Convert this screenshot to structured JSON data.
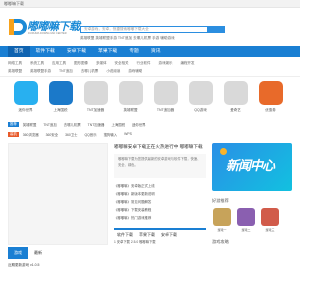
{
  "topbar": {
    "text": "嘟嘟嘛下载"
  },
  "header": {
    "logo_text": "嘟嘟嘛下载",
    "logo_sub": "DUDUMA DOWNLOAD CENTER",
    "search_placeholder": "安卓游戏，安卓，快捷搜索嘟嘟下载大全",
    "hotwords": "英雄联盟 英雄联盟手游 TNT追加 去哪儿机票 手游 辅助游戏"
  },
  "nav": {
    "items": [
      "首页",
      "软件下载",
      "安卓下载",
      "苹果下载",
      "专题",
      "资讯"
    ]
  },
  "subnav": {
    "row1": [
      "网络工具",
      "系统工具",
      "应用工具",
      "图形图像",
      "多媒体",
      "安全相关",
      "行业软件",
      "游戏娱乐",
      "编程开发"
    ],
    "row2": [
      "英雄联盟",
      "英雄联盟手游",
      "TNT追加",
      "去哪儿机票",
      "小说阅读",
      "游戏辅助"
    ]
  },
  "apps": [
    {
      "name": "迷你世界",
      "color": "#28b0f0"
    },
    {
      "name": "上海国税",
      "color": "#1b79c9"
    },
    {
      "name": "TNT加速器",
      "color": "#d9d9d9"
    },
    {
      "name": "英雄联盟",
      "color": "#d9d9d9"
    },
    {
      "name": "TNT追加器",
      "color": "#d9d9d9"
    },
    {
      "name": "QQ游戏",
      "color": "#d9d9d9"
    },
    {
      "name": "爱奇艺",
      "color": "#d9d9d9"
    },
    {
      "name": "优惠券",
      "color": "#e86a2a"
    }
  ],
  "tagrows": [
    {
      "tag": "推荐",
      "color": "#1a7fd3",
      "words": [
        "英雄联盟",
        "TNT追加",
        "去哪儿机票",
        "TNT加速器",
        "上海国税",
        "迷你世界"
      ]
    },
    {
      "tag": "装机",
      "color": "#e85a2a",
      "words": [
        "360浏览器",
        "360安全",
        "360卫士",
        "QQ音乐",
        "搜狗输入",
        "WPS"
      ]
    }
  ],
  "slider": {
    "tabs": [
      "游戏",
      "最新"
    ],
    "foot": "近期更新游戏 v1.0.5"
  },
  "news": {
    "headline": "嘟嘟嘛安卓下载正在火热进行中 嘟嘟嘛下载",
    "summary": "嘟嘟嘛下载为您提供最新的安卓游戏与软件下载，快速、安全、绿色。",
    "list": [
      "《嘟嘟嘛》安卓版正式上线",
      "《嘟嘟嘛》新版本更新说明",
      "《嘟嘟嘛》常见问题解答",
      "《嘟嘟嘛》下载安装教程",
      "《嘟嘟嘛》热门游戏推荐"
    ],
    "tabs": [
      "软件下载",
      "苹果下载",
      "安卓下载"
    ],
    "rank": "1  安卓下载 2.5.0 嘟嘟嘛下载"
  },
  "side": {
    "banner_text": "新闻中心",
    "heading1": "好游推荐",
    "thumbs": [
      {
        "name": "游戏一",
        "color": "#c7a35a"
      },
      {
        "name": "游戏二",
        "color": "#8a5fb0"
      },
      {
        "name": "游戏三",
        "color": "#d15b4a"
      }
    ],
    "heading2": "游戏攻略"
  }
}
